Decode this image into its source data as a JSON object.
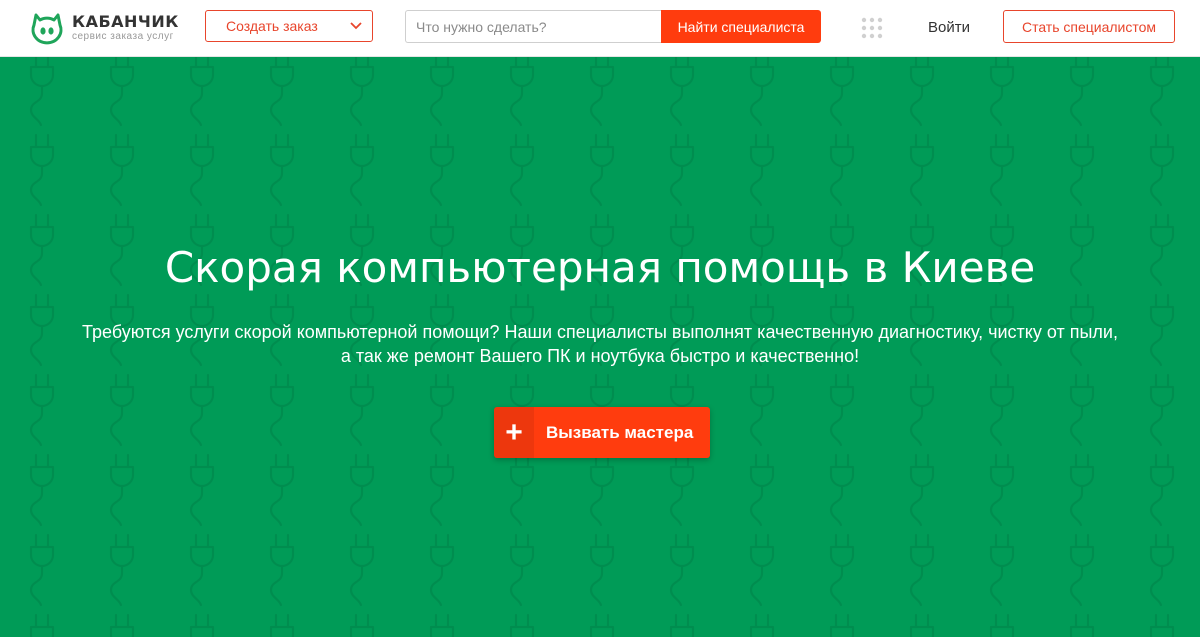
{
  "brand": {
    "name": "КАБАНЧИК",
    "tagline": "сервис заказа услуг"
  },
  "header": {
    "create_order_label": "Создать заказ",
    "search_placeholder": "Что нужно сделать?",
    "search_button": "Найти специалиста",
    "login_label": "Войти",
    "become_specialist": "Стать специалистом"
  },
  "hero": {
    "title": "Скорая компьютерная помощь в Киеве",
    "subtitle_line1": "Требуются услуги скорой компьютерной помощи? Наши специалисты выполнят качественную диагностику, чистку от пыли,",
    "subtitle_line2": "а так же ремонт Вашего ПК и ноутбука быстро и качественно!",
    "cta_icon": "+",
    "cta_label": "Вызвать мастера"
  },
  "icons": {
    "logo": "pig-snout-icon",
    "dropdown": "chevron-down-icon",
    "apps": "apps-grid-icon",
    "pattern": "plug-icon"
  },
  "colors": {
    "accent": "#ff3c0e",
    "accent_border": "#e8452c",
    "hero_bg": "#009b57",
    "logo_green": "#1fa55a"
  }
}
